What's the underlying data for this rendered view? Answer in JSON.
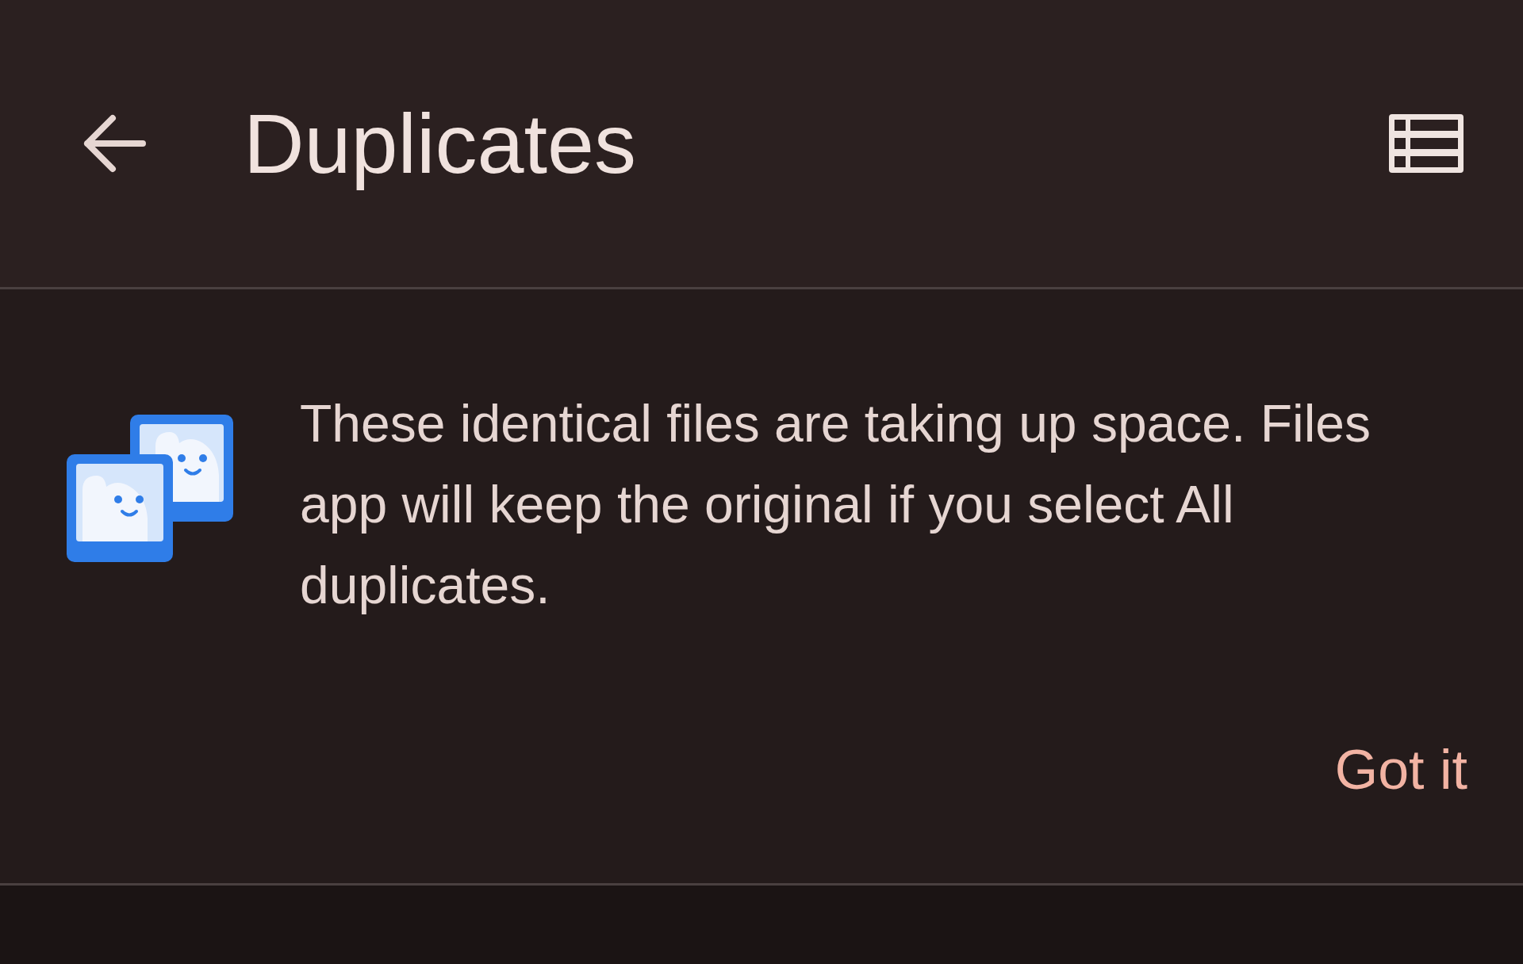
{
  "top_bar": {
    "title": "Duplicates"
  },
  "info_card": {
    "message": "These identical files are taking up space. Files app will keep the original if you select All duplicates.",
    "button": "Got it"
  }
}
